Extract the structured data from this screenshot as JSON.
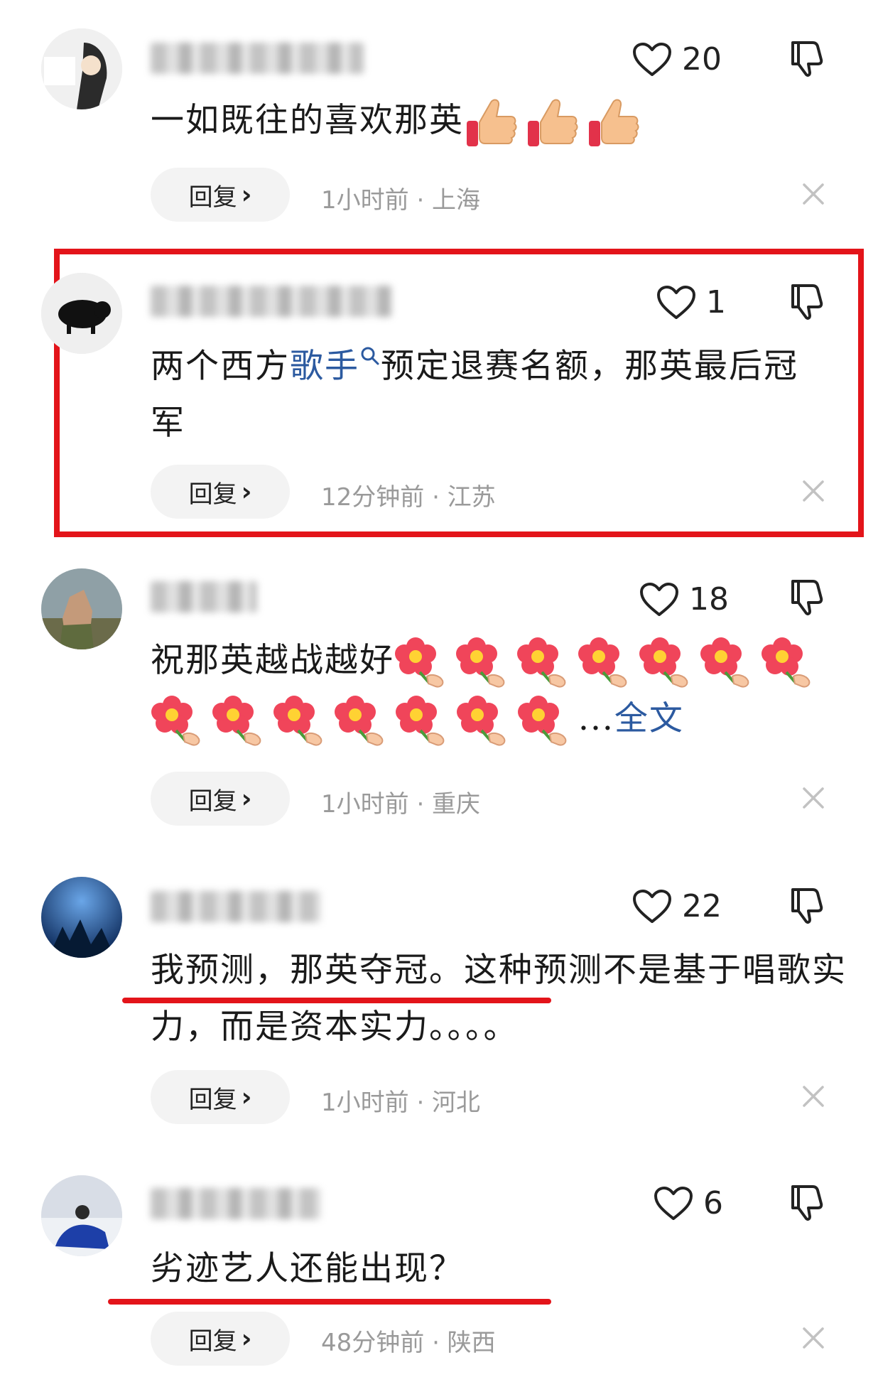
{
  "comments": [
    {
      "likes": "20",
      "text": "一如既往的喜欢那英",
      "emoji_count": 3,
      "time_location": "1小时前 · 上海",
      "reply_label": "回复"
    },
    {
      "likes": "1",
      "text_before": "两个西方",
      "keyword": "歌手",
      "text_after": "预定退赛名额，那英最后冠军",
      "time_location": "12分钟前 · 江苏",
      "reply_label": "回复"
    },
    {
      "likes": "18",
      "text": "祝那英越战越好",
      "emoji_count": 14,
      "more_prefix": "...",
      "more_label": "全文",
      "time_location": "1小时前 · 重庆",
      "reply_label": "回复"
    },
    {
      "likes": "22",
      "text": "我预测，那英夺冠。这种预测不是基于唱歌实力，而是资本实力。。。。",
      "time_location": "1小时前 · 河北",
      "reply_label": "回复"
    },
    {
      "likes": "6",
      "text": "劣迹艺人还能出现？",
      "time_location": "48分钟前 · 陕西",
      "reply_label": "回复"
    }
  ],
  "icons": {
    "like": "heart-outline-icon",
    "dislike": "thumbs-down-icon",
    "close": "close-icon",
    "reply_chevron": "chevron-right-icon",
    "keyword_search": "search-icon",
    "thumbs_up_emoji": "thumbs-up-emoji",
    "flower_emoji": "flower-emoji"
  },
  "colors": {
    "highlight": "#e3141a",
    "link": "#2c5aa0",
    "meta_text": "#9a9a9a",
    "reply_bg": "#f3f3f3"
  }
}
